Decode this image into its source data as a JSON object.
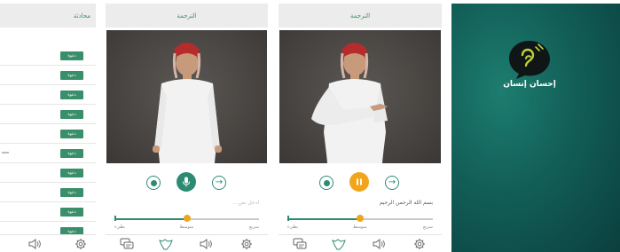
{
  "screens": {
    "chat_list": {
      "title": "محادثة",
      "row_button_label": "دعوة",
      "rows": [
        "دعوة",
        "دعوة",
        "دعوة",
        "دعوة",
        "دعوة",
        "دعوة",
        "دعوة",
        "دعوة",
        "دعوة",
        "دعوة"
      ]
    },
    "translate_idle": {
      "title": "الترجمة",
      "input_placeholder": "ادخل نص...",
      "speed_labels": {
        "slow": "بطيء",
        "medium": "متوسط",
        "fast": "سريع"
      },
      "speed_value": 0.5,
      "main_button_icon": "microphone-icon"
    },
    "translate_active": {
      "title": "الترجمة",
      "input_text": "بسم الله الرحمن الرحيم",
      "speed_labels": {
        "slow": "بطيء",
        "medium": "متوسط",
        "fast": "سريع"
      },
      "speed_value": 0.5,
      "main_button_icon": "pause-icon"
    },
    "splash": {
      "app_name": "إحسان إنسان",
      "logo_icon": "ear-speech-bubble-icon"
    }
  },
  "tabbar": {
    "icons": [
      "chat-icon",
      "sign-hand-icon",
      "speaker-icon",
      "settings-gear-icon"
    ]
  },
  "colors": {
    "brand_green": "#2e8b73",
    "accent_orange": "#f2a51a",
    "header_bg": "#ececec",
    "splash_teal": "#125e57"
  }
}
